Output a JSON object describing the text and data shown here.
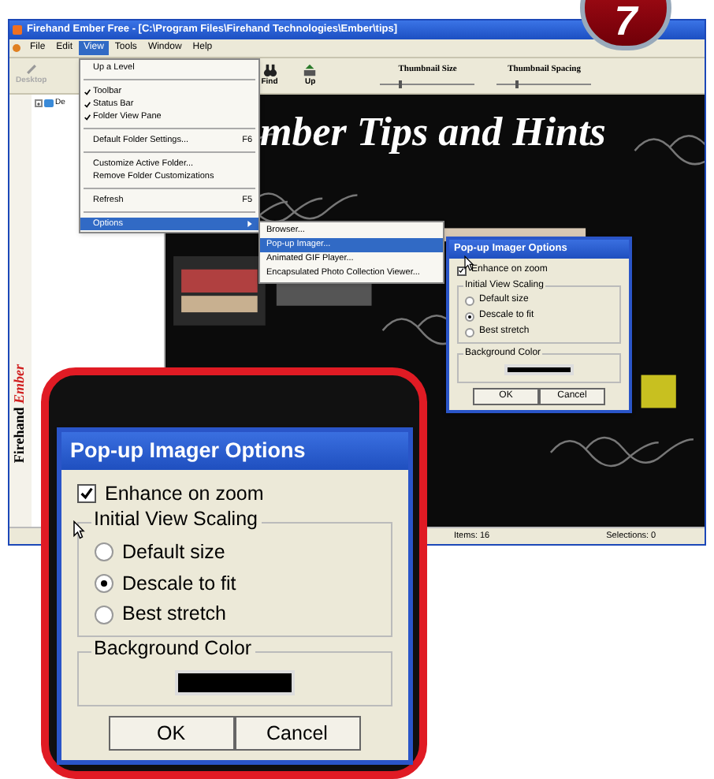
{
  "badge": {
    "text": "7"
  },
  "window": {
    "title": "Firehand Ember Free - [C:\\Program Files\\Firehand Technologies\\Ember\\tips]"
  },
  "menu_bar": [
    {
      "label": "File",
      "selected": false
    },
    {
      "label": "Edit",
      "selected": false
    },
    {
      "label": "View",
      "selected": true
    },
    {
      "label": "Tools",
      "selected": false
    },
    {
      "label": "Window",
      "selected": false
    },
    {
      "label": "Help",
      "selected": false
    }
  ],
  "toolbar": {
    "buttons": [
      {
        "label": "Desktop",
        "kind": "desktop",
        "disabled": true
      },
      {
        "label": "Find",
        "kind": "find",
        "disabled": false
      },
      {
        "label": "Up",
        "kind": "up",
        "disabled": false
      }
    ],
    "sliders": [
      {
        "label": "Thumbnail Size",
        "level": 0.2
      },
      {
        "label": "Thumbnail Spacing",
        "level": 0.2
      }
    ]
  },
  "folder_tree": [
    {
      "label": "De",
      "expanded": false
    }
  ],
  "side_logo": {
    "text": "Firehand",
    "accent": "Ember"
  },
  "content": {
    "heading": "mber Tips and Hints"
  },
  "view_menu": [
    {
      "kind": "item",
      "label": "Up a Level",
      "checked": false,
      "selected": false
    },
    {
      "kind": "separator"
    },
    {
      "kind": "item",
      "label": "Toolbar",
      "checked": true,
      "selected": false
    },
    {
      "kind": "item",
      "label": "Status Bar",
      "checked": true,
      "selected": false
    },
    {
      "kind": "item",
      "label": "Folder View Pane",
      "checked": true,
      "selected": false
    },
    {
      "kind": "separator"
    },
    {
      "kind": "item",
      "label": "Default Folder Settings...",
      "shortcut": "F6",
      "checked": false,
      "selected": false
    },
    {
      "kind": "separator"
    },
    {
      "kind": "item",
      "label": "Customize Active Folder...",
      "checked": false,
      "selected": false
    },
    {
      "kind": "item",
      "label": "Remove Folder Customizations",
      "checked": false,
      "selected": false
    },
    {
      "kind": "separator"
    },
    {
      "kind": "item",
      "label": "Refresh",
      "shortcut": "F5",
      "checked": false,
      "selected": false
    },
    {
      "kind": "separator"
    },
    {
      "kind": "submenu",
      "label": "Options",
      "checked": false,
      "selected": true
    }
  ],
  "options_submenu": [
    {
      "label": "Browser...",
      "selected": false
    },
    {
      "label": "Pop-up Imager...",
      "selected": true
    },
    {
      "label": "Animated GIF Player...",
      "selected": false
    },
    {
      "label": "Encapsulated Photo Collection Viewer...",
      "selected": false
    }
  ],
  "small_dialog": {
    "title": "Pop-up Imager Options",
    "enhance": {
      "label": "Enhance on zoom",
      "checked": true
    },
    "scaling": {
      "title": "Initial View Scaling",
      "options": [
        {
          "label": "Default size",
          "selected": false
        },
        {
          "label": "Descale to fit",
          "selected": true
        },
        {
          "label": "Best stretch",
          "selected": false
        }
      ]
    },
    "background": {
      "title": "Background Color",
      "color": "#000000"
    },
    "buttons": [
      "OK",
      "Cancel"
    ]
  },
  "status_bar": {
    "items": "Items: 16",
    "selections": "Selections: 0"
  },
  "zoomed_dialog": {
    "title": "Pop-up Imager Options",
    "enhance": {
      "label": "Enhance on zoom",
      "checked": true
    },
    "scaling": {
      "title": "Initial View Scaling",
      "options": [
        {
          "label": "Default size",
          "selected": false
        },
        {
          "label": "Descale to fit",
          "selected": true
        },
        {
          "label": "Best stretch",
          "selected": false
        }
      ]
    },
    "background": {
      "title": "Background Color",
      "color": "#000000"
    },
    "buttons": [
      "OK",
      "Cancel"
    ]
  }
}
